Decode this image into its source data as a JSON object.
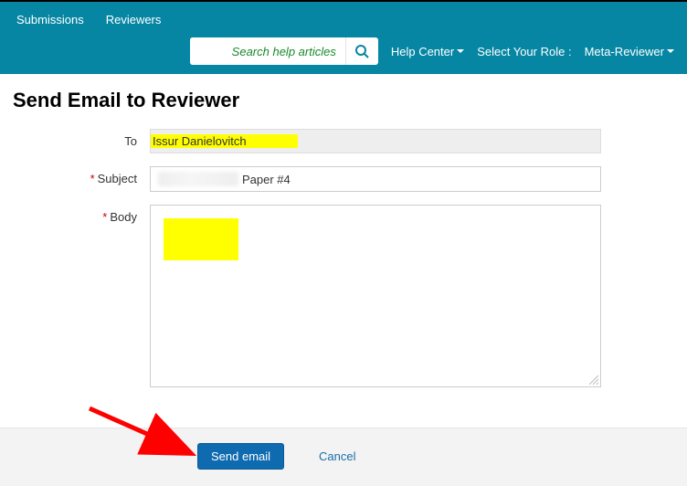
{
  "nav": {
    "submissions": "Submissions",
    "reviewers": "Reviewers",
    "search_placeholder": "Search help articles",
    "help_center": "Help Center",
    "select_role": "Select Your Role :",
    "meta_reviewer": "Meta-Reviewer"
  },
  "page": {
    "title": "Send Email to Reviewer"
  },
  "form": {
    "to_label": "To",
    "to_value": "Issur Danielovitch",
    "subject_label": "Subject",
    "subject_value": "Paper #4",
    "body_label": "Body"
  },
  "footer": {
    "send": "Send email",
    "cancel": "Cancel"
  }
}
